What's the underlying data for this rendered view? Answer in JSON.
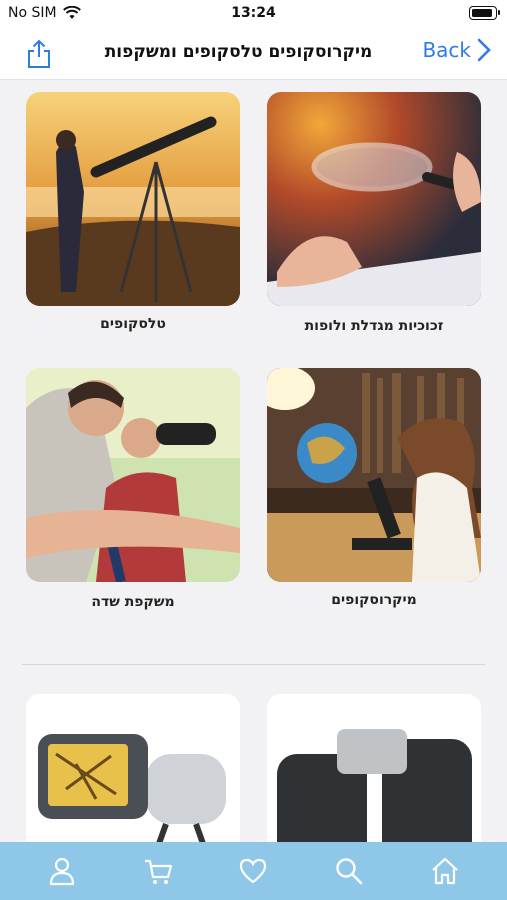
{
  "status_bar": {
    "carrier": "No SIM",
    "time": "13:24"
  },
  "nav": {
    "title": "מיקרוסקופים טלסקופים ומשקפות",
    "back_label": "Back"
  },
  "categories": [
    {
      "label": "זכוכיות מגדלת ולופות",
      "icon": "magnifying-glass"
    },
    {
      "label": "טלסקופים",
      "icon": "telescope"
    },
    {
      "label": "מיקרוסקופים",
      "icon": "microscope"
    },
    {
      "label": "משקפת שדה",
      "icon": "binoculars"
    }
  ],
  "products": [
    {
      "icon": "binoculars"
    },
    {
      "icon": "digital-microscope"
    }
  ],
  "tabbar": {
    "items": [
      "home-icon",
      "search-icon",
      "heart-icon",
      "cart-icon",
      "user-icon"
    ],
    "color": "#8fc7e8"
  },
  "colors": {
    "accent": "#2f7be5",
    "background": "#f2f2f4"
  }
}
